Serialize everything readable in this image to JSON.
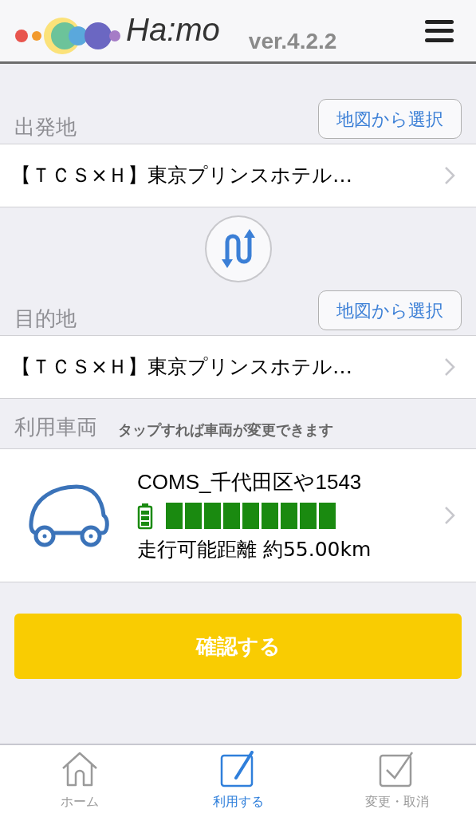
{
  "header": {
    "logo_text": "Ha:mo",
    "version": "ver.4.2.2"
  },
  "origin": {
    "label": "出発地",
    "map_button": "地図から選択",
    "value": "【ＴＣＳ×Ｈ】東京プリンスホテル…"
  },
  "destination": {
    "label": "目的地",
    "map_button": "地図から選択",
    "value": "【ＴＣＳ×Ｈ】東京プリンスホテル…"
  },
  "vehicle": {
    "label": "利用車両",
    "hint": "タップすれば車両が変更できます",
    "name": "COMS_千代田区や1543",
    "battery": {
      "level": 1.0
    },
    "range": "走行可能距離 約55.00km"
  },
  "confirm_button": "確認する",
  "tabs": [
    {
      "label": "ホーム",
      "kind": "home",
      "selected": false
    },
    {
      "label": "利用する",
      "kind": "use",
      "selected": true
    },
    {
      "label": "変更・取消",
      "kind": "change",
      "selected": false
    }
  ]
}
